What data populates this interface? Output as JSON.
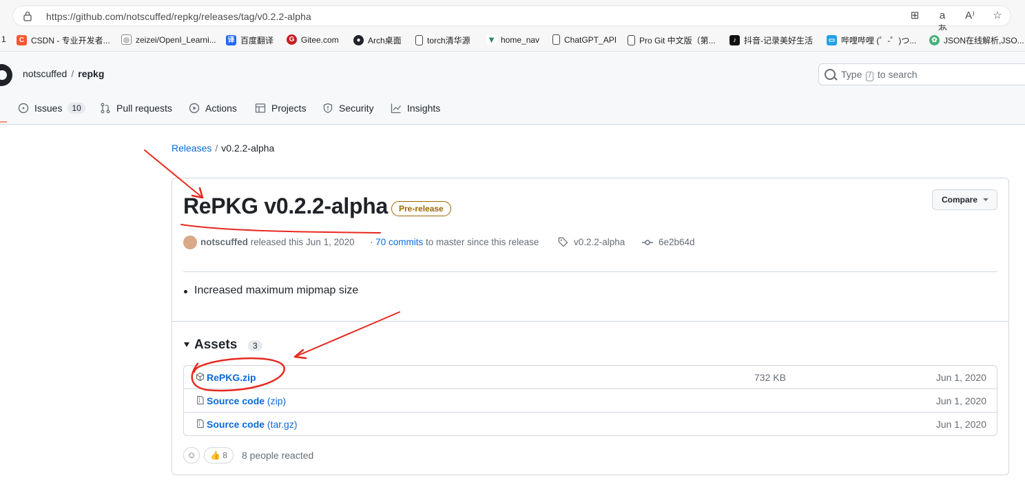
{
  "browser": {
    "url": "https://github.com/notscuffed/repkg/releases/tag/v0.2.2-alpha",
    "bookmarks": [
      {
        "label": "1",
        "icon": "tab-number"
      },
      {
        "label": "CSDN - 专业开发者...",
        "icon": "csdn-icon",
        "color": "#fc5531"
      },
      {
        "label": "zeizei/OpenI_Learni...",
        "icon": "openi-icon",
        "color": "#888888"
      },
      {
        "label": "百度翻译",
        "icon": "baidu-translate-icon",
        "color": "#2468f2"
      },
      {
        "label": "Gitee.com",
        "icon": "gitee-icon",
        "color": "#c71d23"
      },
      {
        "label": "Arch桌面",
        "icon": "github-icon",
        "color": "#1f2328"
      },
      {
        "label": "torch清华源",
        "icon": "page-icon",
        "color": "#ffffff"
      },
      {
        "label": "home_nav",
        "icon": "vue-icon",
        "color": "#2f8a5e"
      },
      {
        "label": "ChatGPT_API",
        "icon": "page-icon",
        "color": "#ffffff"
      },
      {
        "label": "Pro Git 中文版（第...",
        "icon": "page-icon",
        "color": "#ffffff"
      },
      {
        "label": "抖音-记录美好生活",
        "icon": "douyin-icon",
        "color": "#111111"
      },
      {
        "label": "哔哩哔哩 (゜-゜)つ...",
        "icon": "bilibili-icon",
        "color": "#1fa1e6"
      },
      {
        "label": "JSON在线解析,JSO...",
        "icon": "json-icon",
        "color": "#49b07a"
      }
    ]
  },
  "repo": {
    "owner": "notscuffed",
    "separator": "/",
    "name": "repkg"
  },
  "search": {
    "prefix": "Type",
    "key": "/",
    "suffix": "to search"
  },
  "tabs": [
    {
      "label": "Issues",
      "icon": "issue-icon",
      "counter": "10"
    },
    {
      "label": "Pull requests",
      "icon": "pull-request-icon"
    },
    {
      "label": "Actions",
      "icon": "play-icon"
    },
    {
      "label": "Projects",
      "icon": "table-icon"
    },
    {
      "label": "Security",
      "icon": "shield-icon"
    },
    {
      "label": "Insights",
      "icon": "graph-icon"
    }
  ],
  "breadcrumb": {
    "releases": "Releases",
    "separator": "/",
    "current": "v0.2.2-alpha"
  },
  "release": {
    "title": "RePKG v0.2.2-alpha",
    "badge": "Pre-release",
    "compare_label": "Compare",
    "author": "notscuffed",
    "released_text": "released this Jun 1, 2020",
    "commits_link": "70 commits",
    "commits_text": "to master since this release",
    "tag": "v0.2.2-alpha",
    "commit": "6e2b64d",
    "notes": "Increased maximum mipmap size"
  },
  "assets": {
    "heading": "Assets",
    "count": "3",
    "items": [
      {
        "name": "RePKG.zip",
        "suffix": "",
        "size": "732 KB",
        "date": "Jun 1, 2020",
        "icon": "package-icon"
      },
      {
        "name": "Source code",
        "suffix": "(zip)",
        "size": "",
        "date": "Jun 1, 2020",
        "icon": "file-zip-icon"
      },
      {
        "name": "Source code",
        "suffix": "(tar.gz)",
        "size": "",
        "date": "Jun 1, 2020",
        "icon": "file-zip-icon"
      }
    ]
  },
  "reactions": {
    "emoji": "👍",
    "count": "8",
    "text": "8 people reacted"
  },
  "annotation_color": "#e8281e"
}
